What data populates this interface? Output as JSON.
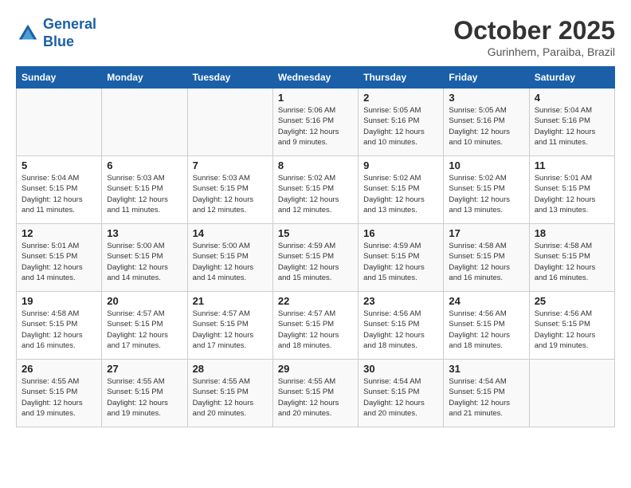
{
  "header": {
    "logo_line1": "General",
    "logo_line2": "Blue",
    "month": "October 2025",
    "location": "Gurinhem, Paraiba, Brazil"
  },
  "days_of_week": [
    "Sunday",
    "Monday",
    "Tuesday",
    "Wednesday",
    "Thursday",
    "Friday",
    "Saturday"
  ],
  "weeks": [
    [
      {
        "day": "",
        "info": ""
      },
      {
        "day": "",
        "info": ""
      },
      {
        "day": "",
        "info": ""
      },
      {
        "day": "1",
        "info": "Sunrise: 5:06 AM\nSunset: 5:16 PM\nDaylight: 12 hours\nand 9 minutes."
      },
      {
        "day": "2",
        "info": "Sunrise: 5:05 AM\nSunset: 5:16 PM\nDaylight: 12 hours\nand 10 minutes."
      },
      {
        "day": "3",
        "info": "Sunrise: 5:05 AM\nSunset: 5:16 PM\nDaylight: 12 hours\nand 10 minutes."
      },
      {
        "day": "4",
        "info": "Sunrise: 5:04 AM\nSunset: 5:16 PM\nDaylight: 12 hours\nand 11 minutes."
      }
    ],
    [
      {
        "day": "5",
        "info": "Sunrise: 5:04 AM\nSunset: 5:15 PM\nDaylight: 12 hours\nand 11 minutes."
      },
      {
        "day": "6",
        "info": "Sunrise: 5:03 AM\nSunset: 5:15 PM\nDaylight: 12 hours\nand 11 minutes."
      },
      {
        "day": "7",
        "info": "Sunrise: 5:03 AM\nSunset: 5:15 PM\nDaylight: 12 hours\nand 12 minutes."
      },
      {
        "day": "8",
        "info": "Sunrise: 5:02 AM\nSunset: 5:15 PM\nDaylight: 12 hours\nand 12 minutes."
      },
      {
        "day": "9",
        "info": "Sunrise: 5:02 AM\nSunset: 5:15 PM\nDaylight: 12 hours\nand 13 minutes."
      },
      {
        "day": "10",
        "info": "Sunrise: 5:02 AM\nSunset: 5:15 PM\nDaylight: 12 hours\nand 13 minutes."
      },
      {
        "day": "11",
        "info": "Sunrise: 5:01 AM\nSunset: 5:15 PM\nDaylight: 12 hours\nand 13 minutes."
      }
    ],
    [
      {
        "day": "12",
        "info": "Sunrise: 5:01 AM\nSunset: 5:15 PM\nDaylight: 12 hours\nand 14 minutes."
      },
      {
        "day": "13",
        "info": "Sunrise: 5:00 AM\nSunset: 5:15 PM\nDaylight: 12 hours\nand 14 minutes."
      },
      {
        "day": "14",
        "info": "Sunrise: 5:00 AM\nSunset: 5:15 PM\nDaylight: 12 hours\nand 14 minutes."
      },
      {
        "day": "15",
        "info": "Sunrise: 4:59 AM\nSunset: 5:15 PM\nDaylight: 12 hours\nand 15 minutes."
      },
      {
        "day": "16",
        "info": "Sunrise: 4:59 AM\nSunset: 5:15 PM\nDaylight: 12 hours\nand 15 minutes."
      },
      {
        "day": "17",
        "info": "Sunrise: 4:58 AM\nSunset: 5:15 PM\nDaylight: 12 hours\nand 16 minutes."
      },
      {
        "day": "18",
        "info": "Sunrise: 4:58 AM\nSunset: 5:15 PM\nDaylight: 12 hours\nand 16 minutes."
      }
    ],
    [
      {
        "day": "19",
        "info": "Sunrise: 4:58 AM\nSunset: 5:15 PM\nDaylight: 12 hours\nand 16 minutes."
      },
      {
        "day": "20",
        "info": "Sunrise: 4:57 AM\nSunset: 5:15 PM\nDaylight: 12 hours\nand 17 minutes."
      },
      {
        "day": "21",
        "info": "Sunrise: 4:57 AM\nSunset: 5:15 PM\nDaylight: 12 hours\nand 17 minutes."
      },
      {
        "day": "22",
        "info": "Sunrise: 4:57 AM\nSunset: 5:15 PM\nDaylight: 12 hours\nand 18 minutes."
      },
      {
        "day": "23",
        "info": "Sunrise: 4:56 AM\nSunset: 5:15 PM\nDaylight: 12 hours\nand 18 minutes."
      },
      {
        "day": "24",
        "info": "Sunrise: 4:56 AM\nSunset: 5:15 PM\nDaylight: 12 hours\nand 18 minutes."
      },
      {
        "day": "25",
        "info": "Sunrise: 4:56 AM\nSunset: 5:15 PM\nDaylight: 12 hours\nand 19 minutes."
      }
    ],
    [
      {
        "day": "26",
        "info": "Sunrise: 4:55 AM\nSunset: 5:15 PM\nDaylight: 12 hours\nand 19 minutes."
      },
      {
        "day": "27",
        "info": "Sunrise: 4:55 AM\nSunset: 5:15 PM\nDaylight: 12 hours\nand 19 minutes."
      },
      {
        "day": "28",
        "info": "Sunrise: 4:55 AM\nSunset: 5:15 PM\nDaylight: 12 hours\nand 20 minutes."
      },
      {
        "day": "29",
        "info": "Sunrise: 4:55 AM\nSunset: 5:15 PM\nDaylight: 12 hours\nand 20 minutes."
      },
      {
        "day": "30",
        "info": "Sunrise: 4:54 AM\nSunset: 5:15 PM\nDaylight: 12 hours\nand 20 minutes."
      },
      {
        "day": "31",
        "info": "Sunrise: 4:54 AM\nSunset: 5:15 PM\nDaylight: 12 hours\nand 21 minutes."
      },
      {
        "day": "",
        "info": ""
      }
    ]
  ]
}
